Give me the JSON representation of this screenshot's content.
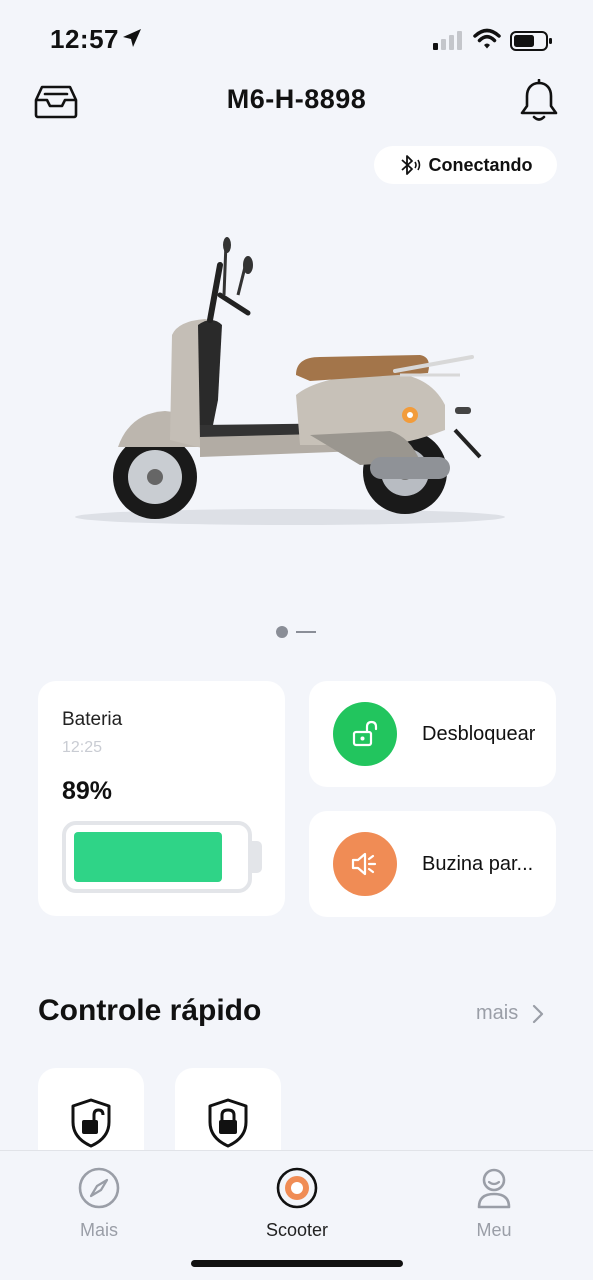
{
  "status_bar": {
    "time": "12:57"
  },
  "header": {
    "title": "M6-H-8898"
  },
  "connection": {
    "label": "Conectando"
  },
  "battery": {
    "label": "Bateria",
    "time": "12:25",
    "percent_text": "89%",
    "level": 0.89,
    "color": "#2fd487"
  },
  "actions": [
    {
      "label": "Desbloquear",
      "color": "#22c55e",
      "icon": "unlock-icon"
    },
    {
      "label": "Buzina par...",
      "color": "#f08c55",
      "icon": "horn-icon"
    }
  ],
  "quick_control": {
    "title": "Controle rápido",
    "more_label": "mais",
    "items": [
      {
        "icon": "shield-unlock-icon"
      },
      {
        "icon": "shield-lock-icon"
      }
    ]
  },
  "tabbar": {
    "tabs": [
      {
        "label": "Mais",
        "icon": "compass-icon",
        "active": false
      },
      {
        "label": "Scooter",
        "icon": "scooter-target-icon",
        "active": true
      },
      {
        "label": "Meu",
        "icon": "person-icon",
        "active": false
      }
    ]
  },
  "colors": {
    "background": "#f3f5fa",
    "accent": "#f08c55"
  }
}
